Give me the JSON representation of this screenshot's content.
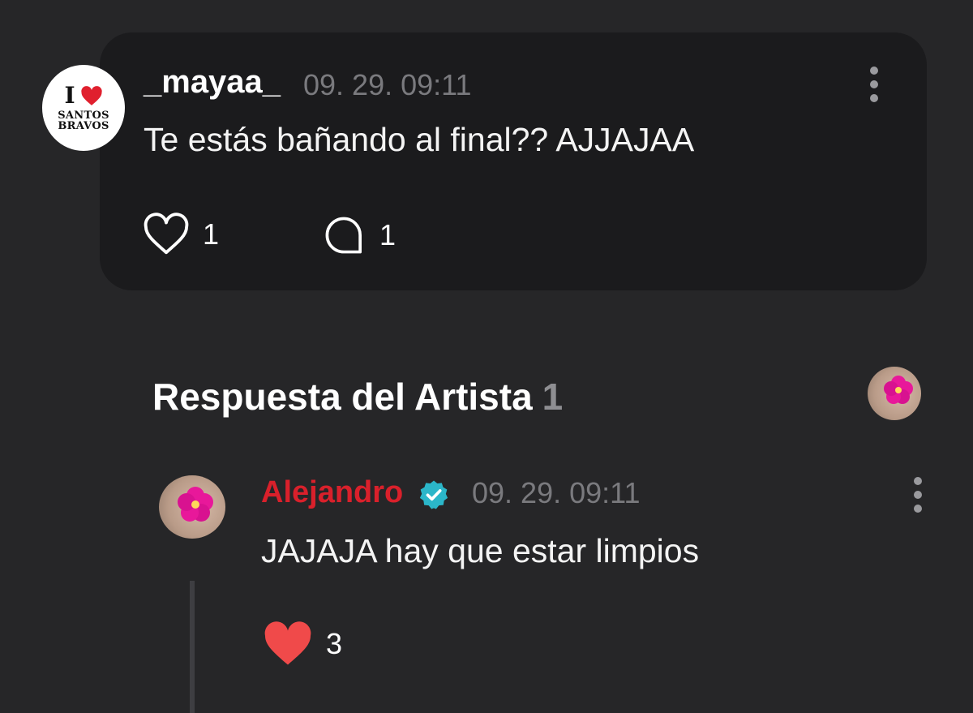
{
  "comment": {
    "avatar": {
      "line1": "I",
      "line2": "SANTOS",
      "line3": "BRAVOS",
      "heart_color": "#e0202e"
    },
    "username": "_mayaa_",
    "timestamp": "09. 29. 09:11",
    "text": "Te estás bañando al final?? AJJAJAA",
    "likes": "1",
    "replies": "1",
    "menu_icon": "kebab-menu-icon"
  },
  "artist_reply": {
    "section_title": "Respuesta del Artista",
    "section_count": "1",
    "author": "Alejandro",
    "author_color": "#d9202b",
    "verified_color": "#2bb6c9",
    "timestamp": "09. 29. 09:11",
    "text": "JAJAJA hay que estar limpios",
    "likes": "3",
    "liked_heart_color": "#f04a4a",
    "menu_icon": "kebab-menu-icon"
  }
}
